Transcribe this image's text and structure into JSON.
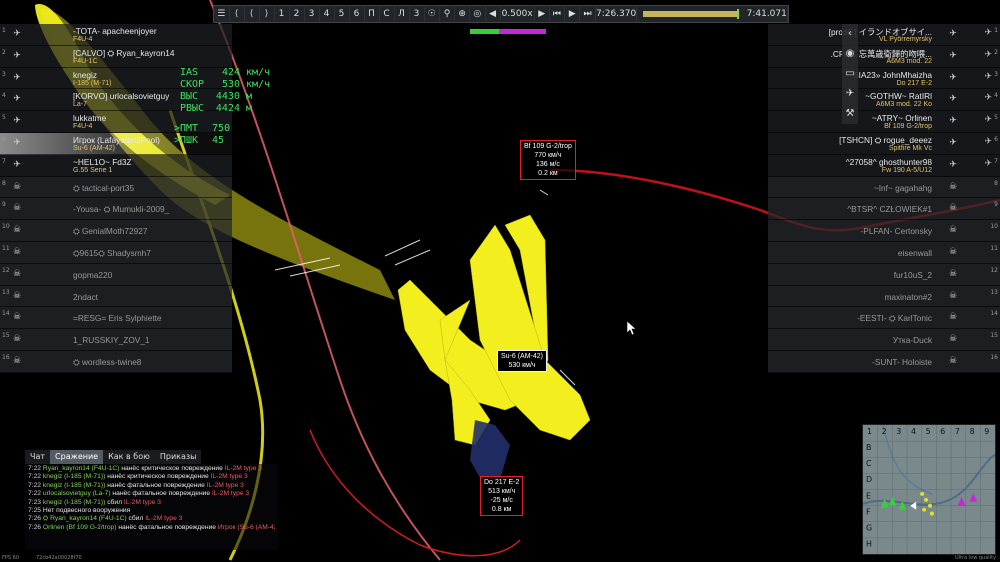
{
  "replay": {
    "buttons": [
      "⟨",
      "⟨",
      "⟩",
      "1",
      "2",
      "3",
      "4",
      "5",
      "6",
      "П",
      "С",
      "Л",
      "3"
    ],
    "speed": "0.500x",
    "current_time": "7:26.370",
    "total_time": "7:41.071",
    "progress_fraction": 0.965
  },
  "score": {
    "green_fraction": 0.38,
    "purple_fraction": 0.62
  },
  "left_team": [
    {
      "num": "1",
      "name": "-TOTA- apacheenjoyer",
      "vehicle": "F4U-4",
      "alive": true
    },
    {
      "num": "2",
      "name": "[CALVO] ⛭ Ryan_kayron14",
      "vehicle": "F4U-1C",
      "alive": true
    },
    {
      "num": "3",
      "name": "knegiz",
      "vehicle": "I-185 (M-71)",
      "alive": true
    },
    {
      "num": "4",
      "name": "[KORVO] urlocalsovietguy",
      "vehicle": "La-7",
      "alive": true
    },
    {
      "num": "5",
      "name": "lukkatme",
      "vehicle": "F4U-4",
      "alive": true
    },
    {
      "num": "6",
      "name": "Игрок (LafayetteGPool)",
      "vehicle": "Su-6 (AM-42)",
      "alive": true,
      "highlight": true
    },
    {
      "num": "7",
      "name": "~HEL1O~ Fd3Z",
      "vehicle": "G.55 Serie 1",
      "alive": true
    },
    {
      "num": "8",
      "name": "⛭ tactical-port35",
      "vehicle": "",
      "alive": false
    },
    {
      "num": "9",
      "name": "-Yousa- ⛭ Mumukli-2009_",
      "vehicle": "",
      "alive": false
    },
    {
      "num": "10",
      "name": "⛭ GenialMoth72927",
      "vehicle": "",
      "alive": false
    },
    {
      "num": "11",
      "name": "⛭9615⛭ Shadysmh7",
      "vehicle": "",
      "alive": false
    },
    {
      "num": "12",
      "name": "gopma220",
      "vehicle": "",
      "alive": false
    },
    {
      "num": "13",
      "name": "2ndact",
      "vehicle": "",
      "alive": false
    },
    {
      "num": "14",
      "name": "=RESG= Eris Sylphiette",
      "vehicle": "",
      "alive": false
    },
    {
      "num": "15",
      "name": "1_RUSSKIY_ZOV_1",
      "vehicle": "",
      "alive": false
    },
    {
      "num": "16",
      "name": "⛭ wordless-twine8",
      "vehicle": "",
      "alive": false
    }
  ],
  "right_team": [
    {
      "num": "1",
      "name": "[prodG] イランドオブサイ...",
      "vehicle": "VL Pyörremyrsky",
      "alive": true
    },
    {
      "num": "2",
      "name": ".CPCC 忘萬歳衛歸的吻喂...",
      "vehicle": "A6M3 mod. 22",
      "alive": true
    },
    {
      "num": "3",
      "name": "BIA23» JohnMhaizha",
      "vehicle": "Do 217 E-2",
      "alive": true
    },
    {
      "num": "4",
      "name": "~GOTHW~ RatIRl",
      "vehicle": "A6M3 mod. 22 Ko",
      "alive": true
    },
    {
      "num": "5",
      "name": "~ATRY~ Orlinen",
      "vehicle": "Bf 109 G-2/trop",
      "alive": true
    },
    {
      "num": "6",
      "name": "[TSHCN] ⛭ rogue_deeez",
      "vehicle": "Spitfire Mk Vc",
      "alive": true
    },
    {
      "num": "7",
      "name": "^27058^ ghosthunter98",
      "vehicle": "Fw 190 A-5/U12",
      "alive": true
    },
    {
      "num": "8",
      "name": "~Inf~ gagahahg",
      "vehicle": "",
      "alive": false
    },
    {
      "num": "9",
      "name": "^BTSR^ CZŁOWIEK#1",
      "vehicle": "",
      "alive": false
    },
    {
      "num": "10",
      "name": "-PLFAN- Certonsky",
      "vehicle": "",
      "alive": false
    },
    {
      "num": "11",
      "name": "eisenwall",
      "vehicle": "",
      "alive": false
    },
    {
      "num": "12",
      "name": "fur10uS_2",
      "vehicle": "",
      "alive": false
    },
    {
      "num": "13",
      "name": "maxinaton#2",
      "vehicle": "",
      "alive": false
    },
    {
      "num": "14",
      "name": "-EESTI- ⛭ KarlTonic",
      "vehicle": "",
      "alive": false
    },
    {
      "num": "15",
      "name": "Утка-Duck",
      "vehicle": "",
      "alive": false
    },
    {
      "num": "16",
      "name": "-SUNT- Holoiste",
      "vehicle": "",
      "alive": false
    }
  ],
  "hud": {
    "rows": [
      {
        "k": "IAS",
        "v": "424",
        "u": "км/ч"
      },
      {
        "k": "СКОР",
        "v": "530",
        "u": "км/ч"
      },
      {
        "k": "ВЫС",
        "v": "4430",
        "u": "м"
      },
      {
        "k": "РВЫС",
        "v": "4424",
        "u": "м"
      }
    ],
    "throttle": {
      "k": ">ПМТ",
      "v": "750"
    },
    "flaps": {
      "k": ">ПШК",
      "v": "45"
    }
  },
  "markers": {
    "bf109": {
      "name": "Bf 109 G-2/trop",
      "speed": "770 км/ч",
      "climb": "136 м/с",
      "dist": "0.2 км"
    },
    "self": {
      "name": "Su-6 (AM-42)",
      "speed": "530 км/ч"
    },
    "do217": {
      "name": "Do 217 E-2",
      "speed": "513 км/ч",
      "climb": "-25 м/с",
      "dist": "0.8 км"
    }
  },
  "chat": {
    "tabs": [
      "Чат",
      "Сражение",
      "Как в бою",
      "Приказы"
    ],
    "active_tab": 1,
    "lines": [
      {
        "t": "7:22",
        "nm": "Ryan_kayron14 (F4U-1C)",
        "msg": "нанёс критическое повреждение",
        "tg": "IL-2M type 3"
      },
      {
        "t": "7:22",
        "nm": "knegiz (I-185 (M-71))",
        "msg": "нанёс критическое повреждение",
        "tg": "IL-2M type 3"
      },
      {
        "t": "7:22",
        "nm": "knegiz (I-185 (M-71))",
        "msg": "нанёс фатальное повреждение",
        "tg": "IL-2M type 3"
      },
      {
        "t": "7:22",
        "nm": "urlocalsovietguy (La-7)",
        "msg": "нанёс фатальное повреждение",
        "tg": "IL-2M type 3"
      },
      {
        "t": "7:23",
        "nm": "knegiz (I-185 (M-71))",
        "msg": "сбил",
        "tg": "IL-2M type 3"
      },
      {
        "t": "7:25",
        "nm": "",
        "msg": "Нет подвесного вооружения",
        "tg": ""
      },
      {
        "t": "7:26",
        "nm": "⛭ Ryan_kayron14 (F4U-1C)",
        "msg": "сбил",
        "tg": "IL-2M type 3"
      },
      {
        "t": "7:26",
        "nm": "Orlinen (Bf 109 G-2/trop)",
        "msg": "нанёс фатальное повреждение",
        "tg": "Игрок (Su-6 (AM-42))"
      }
    ]
  },
  "footer": {
    "fps": "FPS 60",
    "session": "72cb42a00028f70",
    "quality": "Ultra low quality"
  },
  "minimap": {
    "cols": [
      "1",
      "2",
      "3",
      "4",
      "5",
      "6",
      "7",
      "8",
      "9"
    ],
    "rows": [
      "B",
      "C",
      "D",
      "E",
      "F",
      "G",
      "H"
    ]
  },
  "colors": {
    "player_plane": "#f0ee1c",
    "enemy_trail": "#e3202a",
    "hud_green": "#3fe05f",
    "team_green": "#36d13a",
    "team_purple": "#c528d6"
  }
}
